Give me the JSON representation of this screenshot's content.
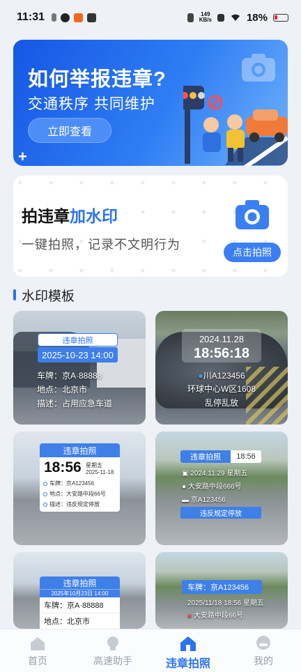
{
  "status_bar": {
    "time": "11:31",
    "net_speed_value": "149",
    "net_speed_unit": "KB/s",
    "battery": "18%"
  },
  "banner": {
    "title": "如何举报违章?",
    "subtitle": "交通秩序   共同维护",
    "cta": "立即查看"
  },
  "watermark_card": {
    "headline_plain": "拍违章",
    "headline_accent": "加水印",
    "tagline": "一键拍照，记录不文明行为",
    "button": "点击拍照"
  },
  "section": {
    "title": "水印模板"
  },
  "templates": {
    "t1": {
      "ribbon": "违章拍照",
      "datetime": "2025-10-23  14:00",
      "plate": "车牌：京A·88888",
      "place": "地点：北京市",
      "desc": "描述：占用应急车道"
    },
    "t2": {
      "date": "2024.11.28",
      "time": "18:56:18",
      "plate": "川A123456",
      "place": "环球中心W区1608",
      "desc": "乱停乱放"
    },
    "t3": {
      "header": "违章拍照",
      "time": "18:56",
      "weekday": "星期五",
      "date": "2025-11-18",
      "plate": "车牌：京A123456",
      "place": "地点：大安路中段66号",
      "desc": "描述：违反规定停放"
    },
    "t4": {
      "header": "违章拍照",
      "time": "18:56",
      "datetime": "2024.11.29  星期五",
      "place": "大安路中段666号",
      "plate": "京A123456",
      "footer": "违反规定停放"
    },
    "t5": {
      "header": "违章拍照",
      "sub": "2025年10月23日  14:00",
      "plate": "车牌：京A·88888",
      "place": "地点：北京市"
    },
    "t6": {
      "plate": "车牌：京A123456",
      "datetime": "2025/11/18  18:56  星期五",
      "place": "大安路中段66号"
    }
  },
  "tabs": [
    {
      "label": "首页"
    },
    {
      "label": "高速助手"
    },
    {
      "label": "违章拍照"
    },
    {
      "label": "我的"
    }
  ],
  "colors": {
    "accent": "#2b74ee",
    "tab_inactive": "#9aa0aa"
  }
}
